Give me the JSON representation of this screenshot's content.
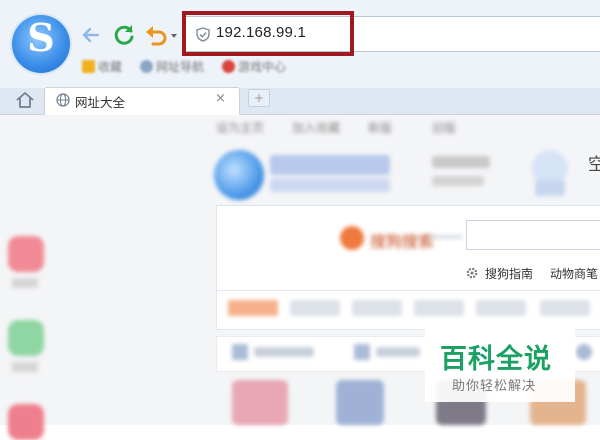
{
  "browser": {
    "logo_letter": "S",
    "address_bar": {
      "url": "192.168.99.1"
    },
    "favorites": [
      {
        "label": "收藏",
        "icon": "star-icon"
      },
      {
        "label": "网址导航",
        "icon": "globe-icon"
      },
      {
        "label": "游戏中心",
        "icon": "game-icon"
      }
    ],
    "tab": {
      "title": "网址大全",
      "close": "×",
      "new_tab": "+"
    }
  },
  "page": {
    "nav_links": [
      "设为主页",
      "加入收藏",
      "新版",
      "旧版"
    ],
    "search": {
      "brand": "搜狗搜索",
      "guide_label": "搜狗指南",
      "hot_label": "动物商笔"
    },
    "weather_char": "空"
  },
  "watermark": {
    "title": "百科全说",
    "subtitle": "助你轻松解决"
  },
  "colors": {
    "highlight": "#a0191e",
    "watermark_green": "#1aa163"
  }
}
